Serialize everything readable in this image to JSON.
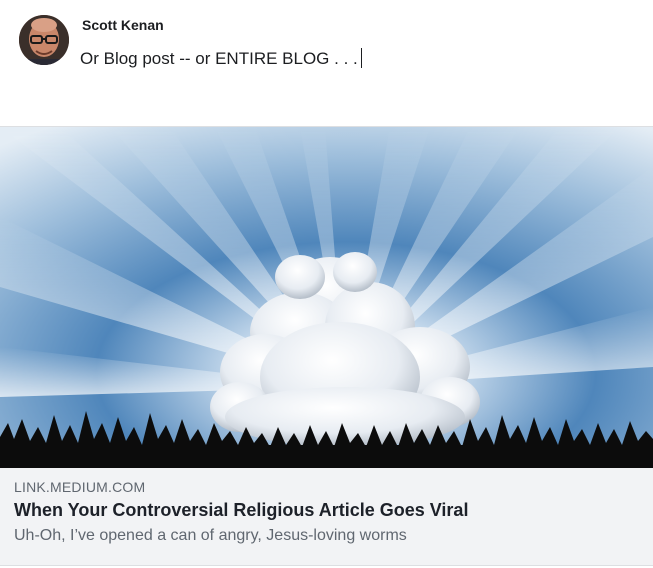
{
  "post": {
    "author_name": "Scott Kenan",
    "avatar_icon": "user-avatar",
    "text": "Or Blog post -- or ENTIRE BLOG . . ."
  },
  "link_preview": {
    "image_description_icon": "sky-cloud-sunrays-image",
    "domain": "LINK.MEDIUM.COM",
    "title": "When Your Controversial Religious Article Goes Viral",
    "description": "Uh-Oh, I’ve opened a can of angry, Jesus-loving worms"
  },
  "colors": {
    "card_background": "#f2f3f5",
    "secondary_text": "#606770",
    "sky_blue": "#2f6fa8"
  }
}
